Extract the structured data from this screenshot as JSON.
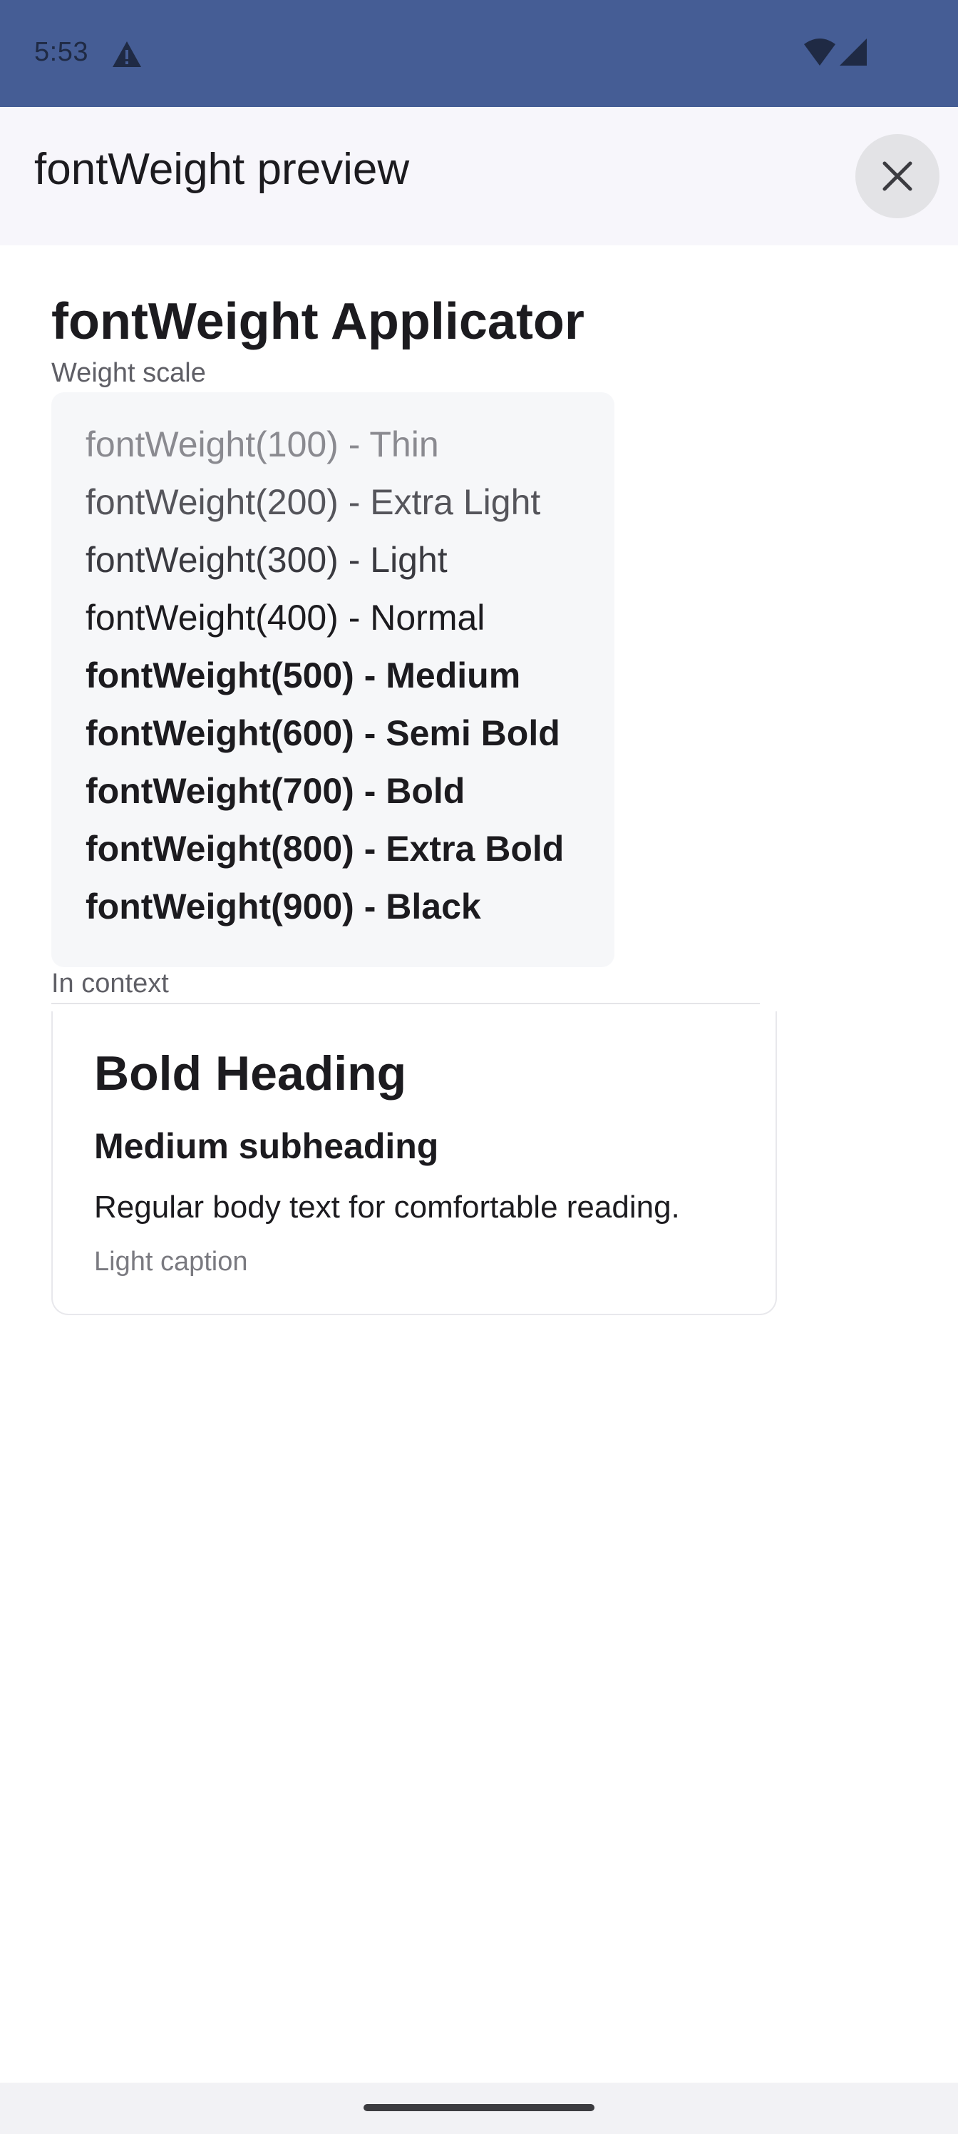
{
  "status_bar": {
    "time": "5:53",
    "icons": [
      "warning-icon",
      "wifi-icon",
      "cell-signal-icon"
    ]
  },
  "app_bar": {
    "title": "fontWeight preview",
    "close_icon": "close-icon"
  },
  "main": {
    "heading": "fontWeight Applicator",
    "weight_scale_label": "Weight scale",
    "weight_scale": [
      {
        "label": "fontWeight(100) - Thin"
      },
      {
        "label": "fontWeight(200) - Extra Light"
      },
      {
        "label": "fontWeight(300) - Light"
      },
      {
        "label": "fontWeight(400) - Normal"
      },
      {
        "label": "fontWeight(500) - Medium"
      },
      {
        "label": "fontWeight(600) - Semi Bold"
      },
      {
        "label": "fontWeight(700) - Bold"
      },
      {
        "label": "fontWeight(800) - Extra Bold"
      },
      {
        "label": "fontWeight(900) - Black"
      }
    ],
    "context_label": "In context",
    "context_card": {
      "heading": "Bold Heading",
      "subheading": "Medium subheading",
      "body": "Regular body text for comfortable reading.",
      "caption": "Light caption"
    }
  },
  "colors": {
    "status_bar": "#455d95",
    "app_bar": "#f7f6fb",
    "scale_box": "#f6f7f9"
  }
}
